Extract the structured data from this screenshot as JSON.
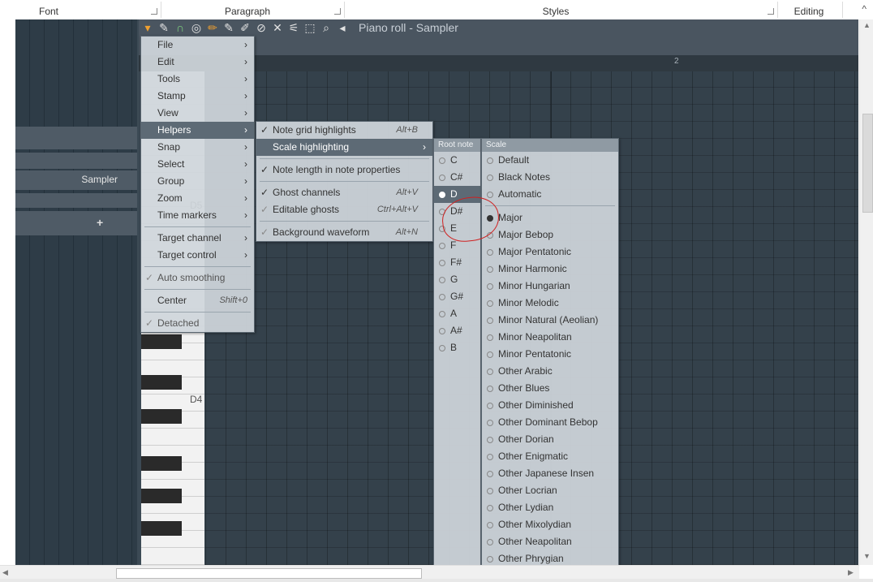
{
  "ribbon": {
    "groups": [
      "Font",
      "Paragraph",
      "Styles",
      "Editing"
    ],
    "collapse_glyph": "^"
  },
  "left_panel": {
    "channel_label": "Sampler",
    "add_label": "+"
  },
  "piano_roll": {
    "title": "Piano roll - Sampler",
    "bar_marker": "2",
    "key_labels": [
      "D5",
      "D4"
    ],
    "toolbar_icons": [
      "menu-icon",
      "wrench-icon",
      "magnet-icon",
      "playback-icon",
      "pencil-icon",
      "paint-icon",
      "erase-icon",
      "mute-icon",
      "slice-icon",
      "select-icon",
      "zoom-icon",
      "speaker-icon",
      "speaker-icon"
    ]
  },
  "main_menu": {
    "items": [
      {
        "label": "File",
        "arrow": true
      },
      {
        "label": "Edit",
        "arrow": true
      },
      {
        "label": "Tools",
        "arrow": true
      },
      {
        "label": "Stamp",
        "arrow": true
      },
      {
        "label": "View",
        "arrow": true
      },
      {
        "label": "Helpers",
        "arrow": true,
        "highlight": true
      },
      {
        "label": "Snap",
        "arrow": true
      },
      {
        "label": "Select",
        "arrow": true
      },
      {
        "label": "Group",
        "arrow": true
      },
      {
        "label": "Zoom",
        "arrow": true
      },
      {
        "label": "Time markers",
        "arrow": true
      },
      {
        "label": "Target channel",
        "arrow": true
      },
      {
        "label": "Target control",
        "arrow": true
      },
      {
        "label": "Auto smoothing"
      },
      {
        "label": "Center",
        "shortcut": "Shift+0"
      },
      {
        "label": "Detached"
      }
    ]
  },
  "helpers_menu": {
    "items": [
      {
        "label": "Note grid highlights",
        "shortcut": "Alt+B",
        "checked": true
      },
      {
        "label": "Scale highlighting",
        "arrow": true,
        "highlight": true
      },
      {
        "label": "Note length in note properties",
        "checked": true
      },
      {
        "label": "Ghost channels",
        "shortcut": "Alt+V",
        "checked": true
      },
      {
        "label": "Editable ghosts",
        "shortcut": "Ctrl+Alt+V"
      },
      {
        "label": "Background waveform",
        "shortcut": "Alt+N"
      }
    ]
  },
  "root_note": {
    "header": "Root note",
    "notes": [
      "C",
      "C#",
      "D",
      "D#",
      "E",
      "F",
      "F#",
      "G",
      "G#",
      "A",
      "A#",
      "B"
    ],
    "selected": "D"
  },
  "scale": {
    "header": "Scale",
    "modes": [
      "Default",
      "Black Notes",
      "Automatic"
    ],
    "scales": [
      "Major",
      "Major Bebop",
      "Major Pentatonic",
      "Minor Harmonic",
      "Minor Hungarian",
      "Minor Melodic",
      "Minor Natural (Aeolian)",
      "Minor Neapolitan",
      "Minor Pentatonic",
      "Other Arabic",
      "Other Blues",
      "Other Diminished",
      "Other Dominant Bebop",
      "Other Dorian",
      "Other Enigmatic",
      "Other Japanese Insen",
      "Other Locrian",
      "Other Lydian",
      "Other Mixolydian",
      "Other Neapolitan",
      "Other Phrygian"
    ],
    "selected": "Major"
  },
  "colors": {
    "highlight": "#5d6a75",
    "menu_bg": "#d0d6dc",
    "annotation": "#d02020"
  }
}
